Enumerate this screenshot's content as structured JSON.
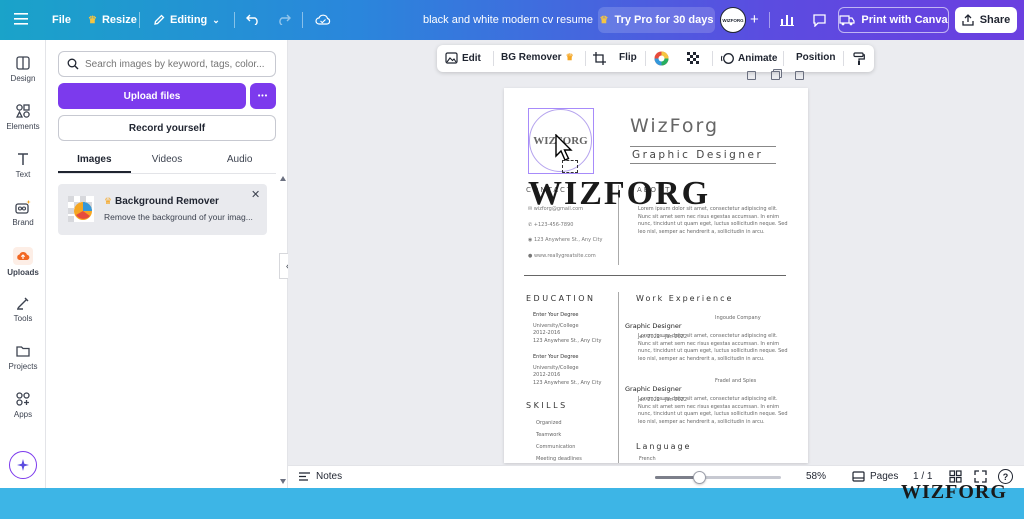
{
  "topbar": {
    "file": "File",
    "resize": "Resize",
    "editing": "Editing",
    "doc_title": "black and white modern cv resume",
    "try_pro": "Try Pro for 30 days",
    "avatar_text": "WIZFORG",
    "print": "Print with Canva",
    "share": "Share"
  },
  "rail": {
    "items": [
      "Design",
      "Elements",
      "Text",
      "Brand",
      "Uploads",
      "Tools",
      "Projects",
      "Apps"
    ]
  },
  "panel": {
    "search_placeholder": "Search images by keyword, tags, color...",
    "upload": "Upload files",
    "more": "•••",
    "record": "Record yourself",
    "tabs": [
      "Images",
      "Videos",
      "Audio"
    ],
    "bg_card": {
      "title": "Background Remover",
      "desc": "Remove the background of your imag..."
    }
  },
  "context_toolbar": {
    "edit": "Edit",
    "bg_remover": "BG Remover",
    "flip": "Flip",
    "animate": "Animate",
    "position": "Position"
  },
  "cv": {
    "logo_text": "WIZFORG",
    "name": "WizForg",
    "role": "Graphic Designer",
    "contact_heading": "CONTACT",
    "about_heading": "ABOUT",
    "contact": [
      "wizforg@gmail.com",
      "+123-456-7890",
      "123 Anywhere St., Any City",
      "www.reallygreatsite.com"
    ],
    "about_text": "Lorem ipsum dolor sit amet, consectetur adipiscing elit. Nunc sit amet sem nec risus egestas accumsan. In enim nunc, tincidunt ut quam eget, luctus sollicitudin neque. Sed leo nisl, semper ac hendrerit a, sollicitudin in arcu.",
    "education_heading": "EDUCATION",
    "education": [
      {
        "degree": "Enter Your Degree",
        "school": "University/College",
        "years": "2012-2016",
        "address": "123 Anywhere St., Any City"
      },
      {
        "degree": "Enter Your Degree",
        "school": "University/College",
        "years": "2012-2016",
        "address": "123 Anywhere St., Any City"
      }
    ],
    "skills_heading": "SKILLS",
    "skills": [
      "Organized",
      "Teamwork",
      "Communication",
      "Meeting deadlines"
    ],
    "work_heading": "Work Experience",
    "work": [
      {
        "title": "Graphic Designer",
        "company": "Ingoude Company",
        "dates": "Jan 2021 - Jan 2022",
        "desc": "Lorem ipsum dolor sit amet, consectetur adipiscing elit. Nunc sit amet sem nec risus egestas accumsan. In enim nunc, tincidunt ut quam eget, luctus sollicitudin neque. Sed leo nisl, semper ac hendrerit a, sollicitudin in arcu."
      },
      {
        "title": "Graphic Designer",
        "company": "Fradel and Spies",
        "dates": "Jan 2021 - Jan 2022",
        "desc": "Lorem ipsum dolor sit amet, consectetur adipiscing elit. Nunc sit amet sem nec risus egestas accumsan. In enim nunc, tincidunt ut quam eget, luctus sollicitudin neque. Sed leo nisl, semper ac hendrerit a, sollicitudin in arcu."
      }
    ],
    "language_heading": "Language",
    "languages": [
      "French"
    ]
  },
  "bottombar": {
    "notes": "Notes",
    "zoom": "58%",
    "zoom_fraction": 0.35,
    "pages": "Pages",
    "page_count": "1 / 1"
  },
  "watermark": {
    "overlay": "WIZFORG",
    "corner": "WIZFORG"
  },
  "colors": {
    "accent": "#7c3aed",
    "selection": "#a78bfa",
    "footer": "#3db5e6"
  }
}
